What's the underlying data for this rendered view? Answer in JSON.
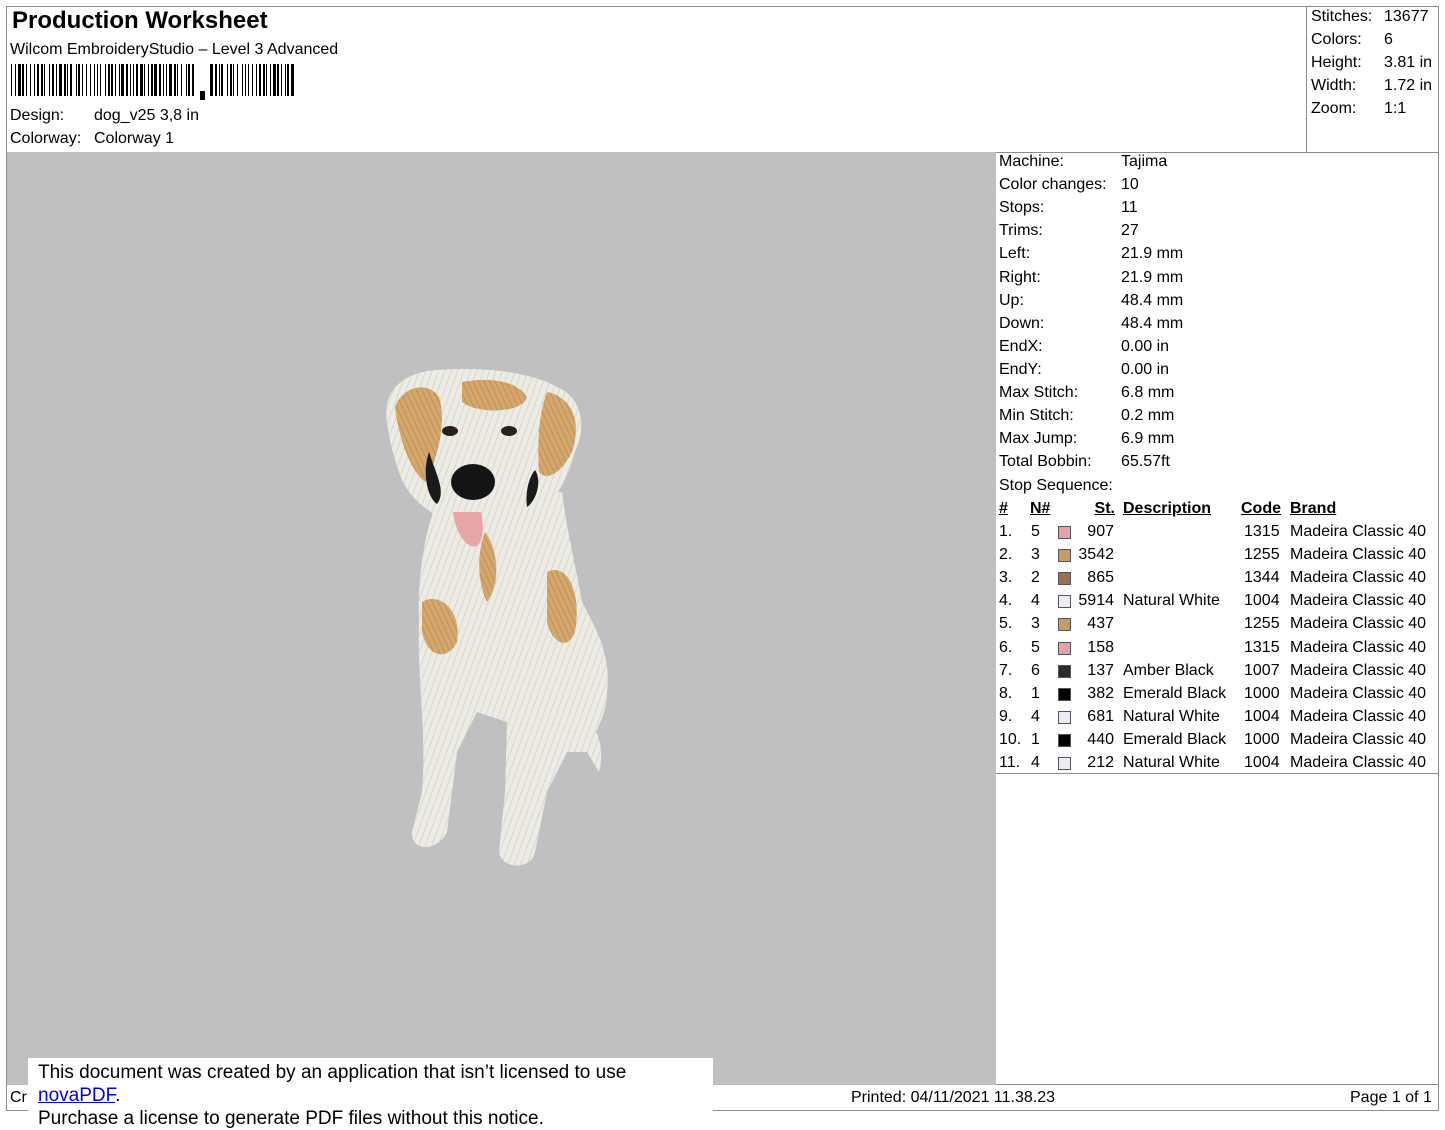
{
  "header": {
    "title": "Production Worksheet",
    "subtitle": "Wilcom EmbroideryStudio – Level 3 Advanced",
    "design_label": "Design:",
    "design_value": "dog_v25 3,8 in",
    "colorway_label": "Colorway:",
    "colorway_value": "Colorway 1"
  },
  "summary": [
    {
      "label": "Stitches:",
      "value": "13677"
    },
    {
      "label": "Colors:",
      "value": "6"
    },
    {
      "label": "Height:",
      "value": "3.81 in"
    },
    {
      "label": "Width:",
      "value": "1.72 in"
    },
    {
      "label": "Zoom:",
      "value": "1:1"
    }
  ],
  "machine_info": [
    {
      "label": "Machine:",
      "value": "Tajima"
    },
    {
      "label": "Color changes:",
      "value": "10"
    },
    {
      "label": "Stops:",
      "value": "11"
    },
    {
      "label": "Trims:",
      "value": "27"
    },
    {
      "label": "Left:",
      "value": "21.9 mm"
    },
    {
      "label": "Right:",
      "value": "21.9 mm"
    },
    {
      "label": "Up:",
      "value": "48.4 mm"
    },
    {
      "label": "Down:",
      "value": "48.4 mm"
    },
    {
      "label": "EndX:",
      "value": "0.00 in"
    },
    {
      "label": "EndY:",
      "value": "0.00 in"
    },
    {
      "label": "Max Stitch:",
      "value": "6.8 mm"
    },
    {
      "label": "Min Stitch:",
      "value": "0.2 mm"
    },
    {
      "label": "Max Jump:",
      "value": "6.9 mm"
    },
    {
      "label": "Total Bobbin:",
      "value": "65.57ft"
    }
  ],
  "stop_sequence": {
    "title": "Stop Sequence:",
    "headers": {
      "num": "#",
      "n": "N#",
      "st": "St.",
      "desc": "Description",
      "code": "Code",
      "brand": "Brand"
    },
    "rows": [
      {
        "num": "1.",
        "n": "5",
        "color": "#e8a0a8",
        "st": "907",
        "desc": "",
        "code": "1315",
        "brand": "Madeira Classic 40"
      },
      {
        "num": "2.",
        "n": "3",
        "color": "#c89868",
        "st": "3542",
        "desc": "",
        "code": "1255",
        "brand": "Madeira Classic 40"
      },
      {
        "num": "3.",
        "n": "2",
        "color": "#9a7050",
        "st": "865",
        "desc": "",
        "code": "1344",
        "brand": "Madeira Classic 40"
      },
      {
        "num": "4.",
        "n": "4",
        "color": "#ececf4",
        "st": "5914",
        "desc": "Natural White",
        "code": "1004",
        "brand": "Madeira Classic 40"
      },
      {
        "num": "5.",
        "n": "3",
        "color": "#c89868",
        "st": "437",
        "desc": "",
        "code": "1255",
        "brand": "Madeira Classic 40"
      },
      {
        "num": "6.",
        "n": "5",
        "color": "#e8a0a8",
        "st": "158",
        "desc": "",
        "code": "1315",
        "brand": "Madeira Classic 40"
      },
      {
        "num": "7.",
        "n": "6",
        "color": "#2a2a2a",
        "st": "137",
        "desc": "Amber Black",
        "code": "1007",
        "brand": "Madeira Classic 40"
      },
      {
        "num": "8.",
        "n": "1",
        "color": "#000000",
        "st": "382",
        "desc": "Emerald Black",
        "code": "1000",
        "brand": "Madeira Classic 40"
      },
      {
        "num": "9.",
        "n": "4",
        "color": "#ececf4",
        "st": "681",
        "desc": "Natural White",
        "code": "1004",
        "brand": "Madeira Classic 40"
      },
      {
        "num": "10.",
        "n": "1",
        "color": "#000000",
        "st": "440",
        "desc": "Emerald Black",
        "code": "1000",
        "brand": "Madeira Classic 40"
      },
      {
        "num": "11.",
        "n": "4",
        "color": "#ececf4",
        "st": "212",
        "desc": "Natural White",
        "code": "1004",
        "brand": "Madeira Classic 40"
      }
    ]
  },
  "footer": {
    "left_fragment": "Cr",
    "printed": "Printed: 04/11/2021 11.38.23",
    "page": "Page 1 of 1"
  },
  "notice": {
    "line1_prefix": "This document was created by an application that isn’t licensed to use ",
    "link": "novaPDF",
    "line1_suffix": ".",
    "line2": "Purchase a license to generate PDF files without this notice."
  },
  "colors": {
    "preview_bg": "#c0c0c0",
    "border": "#8c8c8c"
  }
}
